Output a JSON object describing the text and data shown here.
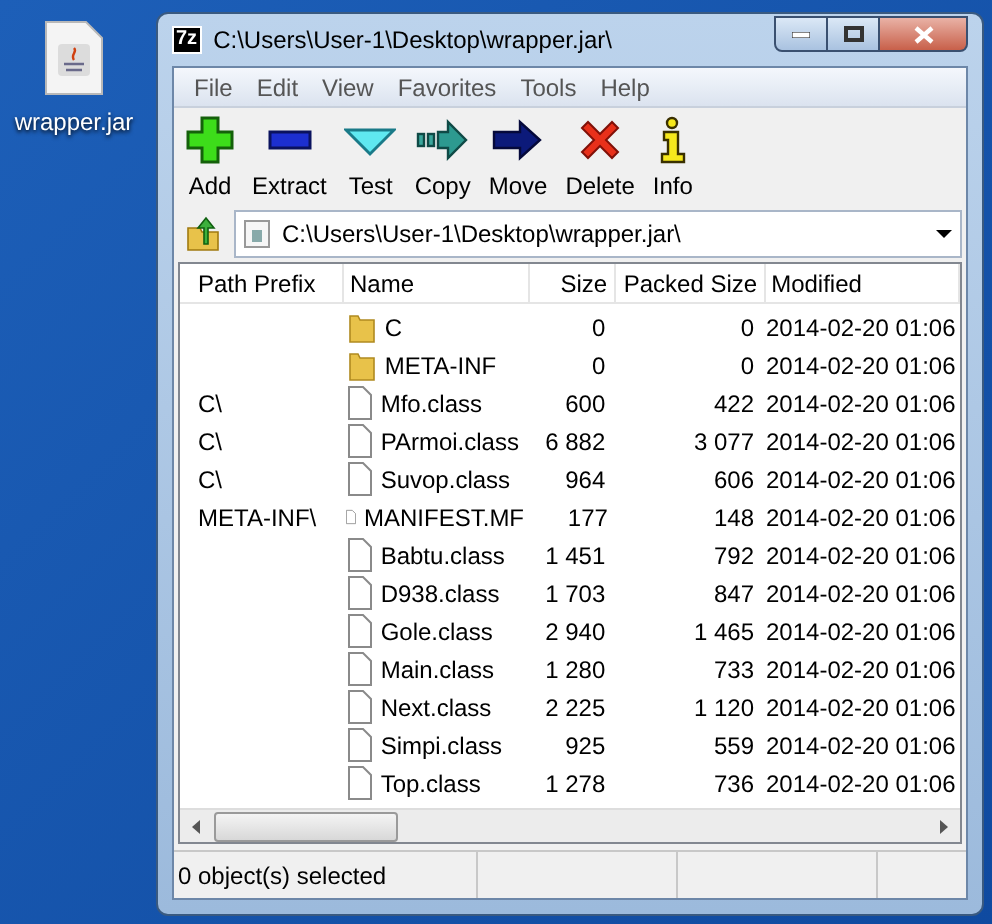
{
  "desktop_icon": {
    "label": "wrapper.jar"
  },
  "window": {
    "logo_text": "7z",
    "title": "C:\\Users\\User-1\\Desktop\\wrapper.jar\\"
  },
  "menu": [
    "File",
    "Edit",
    "View",
    "Favorites",
    "Tools",
    "Help"
  ],
  "toolbar": [
    {
      "kind": "add",
      "label": "Add"
    },
    {
      "kind": "extract",
      "label": "Extract"
    },
    {
      "kind": "test",
      "label": "Test"
    },
    {
      "kind": "copy",
      "label": "Copy"
    },
    {
      "kind": "move",
      "label": "Move"
    },
    {
      "kind": "delete",
      "label": "Delete"
    },
    {
      "kind": "info",
      "label": "Info"
    }
  ],
  "address": {
    "value": "C:\\Users\\User-1\\Desktop\\wrapper.jar\\"
  },
  "table": {
    "columns": [
      "Path Prefix",
      "Name",
      "Size",
      "Packed Size",
      "Modified"
    ],
    "rows": [
      {
        "kind": "folder",
        "prefix": "",
        "name": "C",
        "size": "0",
        "packed": "0",
        "modified": "2014-02-20 01:06"
      },
      {
        "kind": "folder",
        "prefix": "",
        "name": "META-INF",
        "size": "0",
        "packed": "0",
        "modified": "2014-02-20 01:06"
      },
      {
        "kind": "file",
        "prefix": "C\\",
        "name": "Mfo.class",
        "size": "600",
        "packed": "422",
        "modified": "2014-02-20 01:06"
      },
      {
        "kind": "file",
        "prefix": "C\\",
        "name": "PArmoi.class",
        "size": "6 882",
        "packed": "3 077",
        "modified": "2014-02-20 01:06"
      },
      {
        "kind": "file",
        "prefix": "C\\",
        "name": "Suvop.class",
        "size": "964",
        "packed": "606",
        "modified": "2014-02-20 01:06"
      },
      {
        "kind": "file",
        "prefix": "META-INF\\",
        "name": "MANIFEST.MF",
        "size": "177",
        "packed": "148",
        "modified": "2014-02-20 01:06"
      },
      {
        "kind": "file",
        "prefix": "",
        "name": "Babtu.class",
        "size": "1 451",
        "packed": "792",
        "modified": "2014-02-20 01:06"
      },
      {
        "kind": "file",
        "prefix": "",
        "name": "D938.class",
        "size": "1 703",
        "packed": "847",
        "modified": "2014-02-20 01:06"
      },
      {
        "kind": "file",
        "prefix": "",
        "name": "Gole.class",
        "size": "2 940",
        "packed": "1 465",
        "modified": "2014-02-20 01:06"
      },
      {
        "kind": "file",
        "prefix": "",
        "name": "Main.class",
        "size": "1 280",
        "packed": "733",
        "modified": "2014-02-20 01:06"
      },
      {
        "kind": "file",
        "prefix": "",
        "name": "Next.class",
        "size": "2 225",
        "packed": "1 120",
        "modified": "2014-02-20 01:06"
      },
      {
        "kind": "file",
        "prefix": "",
        "name": "Simpi.class",
        "size": "925",
        "packed": "559",
        "modified": "2014-02-20 01:06"
      },
      {
        "kind": "file",
        "prefix": "",
        "name": "Top.class",
        "size": "1 278",
        "packed": "736",
        "modified": "2014-02-20 01:06"
      }
    ]
  },
  "status_bar": {
    "text": "0 object(s) selected"
  }
}
